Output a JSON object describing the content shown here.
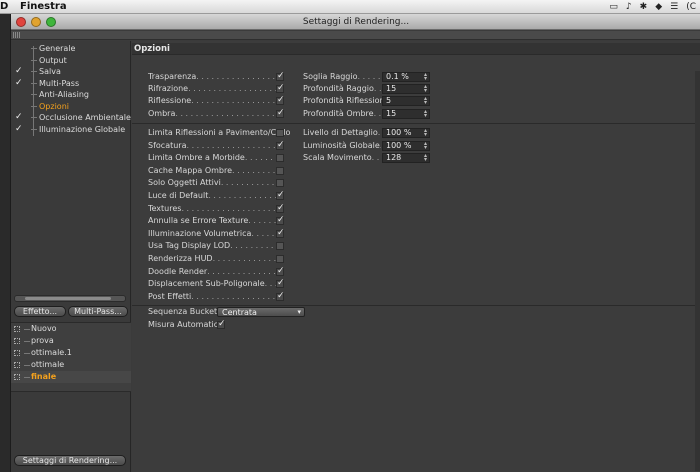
{
  "menubar": {
    "app": "D",
    "menu": "Finestra",
    "tray": [
      "▭",
      "♪",
      "✱",
      "◆",
      "☰",
      "(C"
    ]
  },
  "window": {
    "title": "Settaggi di Rendering..."
  },
  "nav": [
    {
      "label": "Generale",
      "checked": false,
      "selected": false
    },
    {
      "label": "Output",
      "checked": false,
      "selected": false
    },
    {
      "label": "Salva",
      "checked": true,
      "selected": false
    },
    {
      "label": "Multi-Pass",
      "checked": true,
      "selected": false
    },
    {
      "label": "Anti-Aliasing",
      "checked": false,
      "selected": false
    },
    {
      "label": "Opzioni",
      "checked": false,
      "selected": true
    },
    {
      "label": "Occlusione Ambientale",
      "checked": true,
      "selected": false
    },
    {
      "label": "Illuminazione Globale",
      "checked": true,
      "selected": false
    }
  ],
  "buttons": {
    "effect": "Effetto...",
    "multipass": "Multi-Pass...",
    "settings": "Settaggi di Rendering..."
  },
  "presets": [
    {
      "label": "Nuovo",
      "active": false
    },
    {
      "label": "prova",
      "active": false
    },
    {
      "label": "ottimale.1",
      "active": false
    },
    {
      "label": "ottimale",
      "active": false
    },
    {
      "label": "finale",
      "active": true
    }
  ],
  "options": {
    "title": "Opzioni",
    "group1": [
      {
        "label": "Trasparenza",
        "checked": true
      },
      {
        "label": "Rifrazione",
        "checked": true
      },
      {
        "label": "Riflessione",
        "checked": true
      },
      {
        "label": "Ombra",
        "checked": true
      }
    ],
    "fields1": [
      {
        "label": "Soglia Raggio",
        "value": "0.1 %"
      },
      {
        "label": "Profondità Raggio",
        "value": "15"
      },
      {
        "label": "Profondità Riflessione",
        "value": "5"
      },
      {
        "label": "Profondità Ombre",
        "value": "15"
      }
    ],
    "group2": [
      {
        "label": "Limita Riflessioni a Pavimento/Cielo",
        "checked": false
      },
      {
        "label": "Sfocatura",
        "checked": true
      },
      {
        "label": "Limita Ombre a Morbide",
        "checked": false
      },
      {
        "label": "Cache Mappa Ombre",
        "checked": false
      },
      {
        "label": "Solo Oggetti Attivi",
        "checked": false
      },
      {
        "label": "Luce di Default",
        "checked": true
      },
      {
        "label": "Textures",
        "checked": true
      },
      {
        "label": "Annulla se Errore Texture",
        "checked": true
      },
      {
        "label": "Illuminazione Volumetrica",
        "checked": true
      },
      {
        "label": "Usa Tag Display LOD",
        "checked": false
      },
      {
        "label": "Renderizza HUD",
        "checked": false
      },
      {
        "label": "Doodle Render",
        "checked": true
      },
      {
        "label": "Displacement Sub-Poligonale",
        "checked": true
      },
      {
        "label": "Post Effetti",
        "checked": true
      }
    ],
    "fields2": [
      {
        "label": "Livello di Dettaglio",
        "value": "100 %"
      },
      {
        "label": "Luminosità Globale",
        "value": "100 %"
      },
      {
        "label": "Scala Movimento",
        "value": "128"
      }
    ],
    "bucket": {
      "label": "Sequenza Bucket",
      "value": "Centrata"
    },
    "auto": {
      "label": "Misura Automatica",
      "checked": true
    }
  }
}
